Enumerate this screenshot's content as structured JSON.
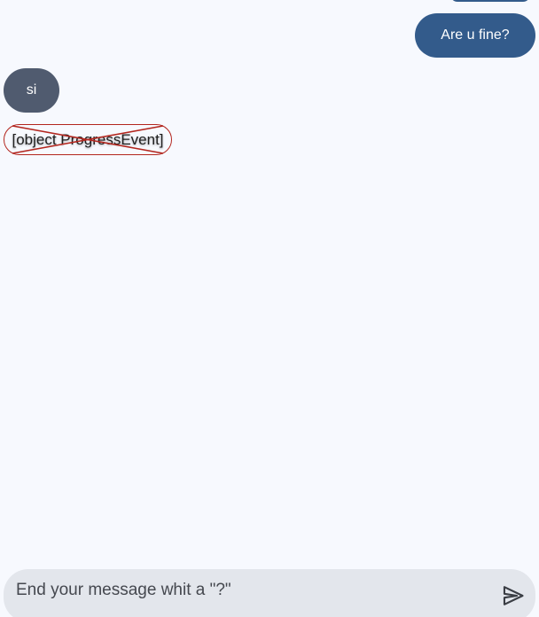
{
  "chat": {
    "messages": [
      {
        "role": "user",
        "text": "Are u fine?"
      },
      {
        "role": "assistant",
        "text": "si"
      },
      {
        "role": "error",
        "text": "[object ProgressEvent]"
      }
    ]
  },
  "composer": {
    "placeholder": "End your message whit a \"?\"",
    "value": ""
  },
  "colors": {
    "background": "#f7f9fe",
    "user_bubble": "#335b8b",
    "assistant_bubble": "#505b6f",
    "error_accent": "#b3261e",
    "composer_bg": "#e3e6ec"
  },
  "icons": {
    "send": "send-icon"
  }
}
